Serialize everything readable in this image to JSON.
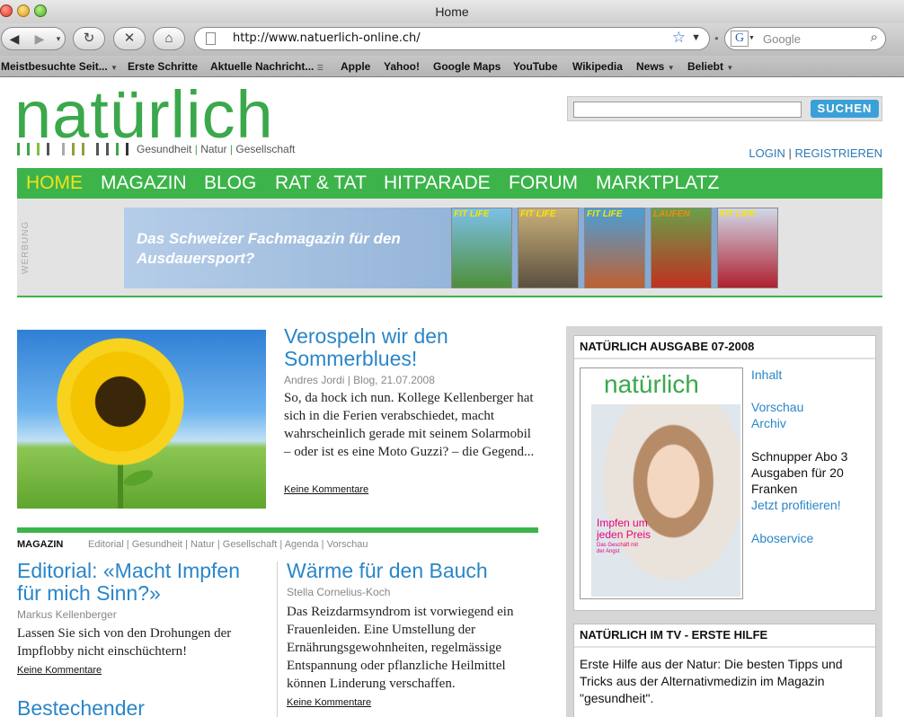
{
  "browser": {
    "window_title": "Home",
    "url": "http://www.natuerlich-online.ch/",
    "search_placeholder": "Google",
    "bookmarks": [
      {
        "label": "Meistbesuchte Seit...",
        "has_menu": true
      },
      {
        "label": "Erste Schritte",
        "has_menu": false
      },
      {
        "label": "Aktuelle Nachricht...",
        "has_menu": false,
        "rss": true
      },
      {
        "label": "Apple",
        "has_menu": false
      },
      {
        "label": "Yahoo!",
        "has_menu": false
      },
      {
        "label": "Google Maps",
        "has_menu": false
      },
      {
        "label": "YouTube",
        "has_menu": false
      },
      {
        "label": "Wikipedia",
        "has_menu": false
      },
      {
        "label": "News",
        "has_menu": true
      },
      {
        "label": "Beliebt",
        "has_menu": true
      }
    ]
  },
  "site": {
    "logo_text": "natürlich",
    "tagline_parts": [
      "Gesundheit",
      "Natur",
      "Gesellschaft"
    ],
    "search_button": "SUCHEN",
    "login": "LOGIN",
    "register": "REGISTRIEREN",
    "nav": [
      "HOME",
      "MAGAZIN",
      "BLOG",
      "RAT & TAT",
      "HITPARADE",
      "FORUM",
      "MARKTPLATZ"
    ],
    "active_nav": "HOME",
    "colors": {
      "green": "#3cb44a",
      "blue": "#2a86c8",
      "yellow_active": "#f2e11e"
    }
  },
  "ad": {
    "label": "WERBUNG",
    "text": "Das Schweizer Fachmagazin für den Ausdauersport?",
    "covers": [
      "FIT LIFE",
      "FIT LIFE",
      "FIT LIFE",
      "LAUFEN",
      "FIT LIFE"
    ]
  },
  "feature": {
    "title": "Verospeln wir den Sommerblues!",
    "meta": "Andres Jordi | Blog, 21.07.2008",
    "body": "So, da hock ich nun. Kollege Kellenberger hat sich in die Ferien verabschiedet, macht wahrscheinlich gerade mit seinem Solarmobil – oder ist es eine Moto Guzzi? – die Gegend...",
    "link": "Keine Kommentare"
  },
  "magazin": {
    "heading": "MAGAZIN",
    "categories": "Editorial | Gesundheit | Natur | Gesellschaft | Agenda | Vorschau",
    "articles": [
      {
        "title": "Editorial: «Macht Impfen für mich Sinn?»",
        "meta": "Markus Kellenberger",
        "body": "Lassen Sie sich von den Drohungen der Impflobby nicht einschüchtern!",
        "link": "Keine Kommentare"
      },
      {
        "title": "Wärme für den Bauch",
        "meta": "Stella Cornelius-Koch",
        "body": "Das Reizdarmsyndrom ist vorwiegend ein Frauenleiden. Eine Umstellung der Ernährungsgewohnheiten, regelmässige Entspannung oder pflanzliche Heilmittel können Linderung verschaffen.",
        "link": "Keine Kommentare"
      },
      {
        "title": "Bestechender"
      }
    ]
  },
  "sidebar": {
    "issue_box": {
      "title": "NATÜRLICH AUSGABE 07-2008",
      "cover": {
        "logo": "natürlich",
        "headline": "Impfen um jeden Preis",
        "subline": "Das Geschäft mit der Angst"
      },
      "links": [
        "Inhalt",
        "Vorschau",
        "Archiv"
      ],
      "abo_text": "Schnupper Abo 3 Ausgaben für 20 Franken",
      "abo_link": "Jetzt profitieren!",
      "service_link": "Aboservice"
    },
    "tv_box": {
      "title": "NATÜRLICH IM TV - ERSTE HILFE",
      "body": "Erste Hilfe aus der Natur: Die besten Tipps und Tricks aus der Alternativmedizin im Magazin \"gesundheit\"."
    }
  }
}
